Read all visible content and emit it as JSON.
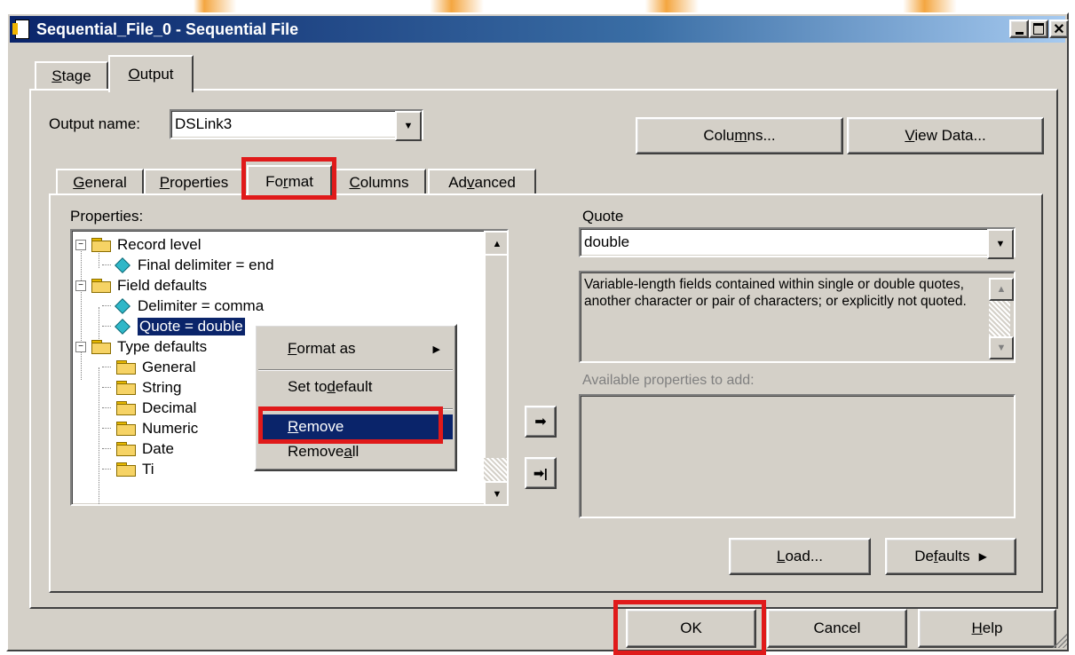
{
  "window": {
    "title": "Sequential_File_0 - Sequential File",
    "title_bar_color": "#0a246a",
    "face_color": "#d4d0c8"
  },
  "top_tabs": [
    {
      "label": "Stage",
      "accel": "S",
      "rest": "tage"
    },
    {
      "label": "Output",
      "accel": "O",
      "rest": "utput",
      "active": true
    }
  ],
  "output_name": {
    "label": "Output name:",
    "value": "DSLink3"
  },
  "top_buttons": {
    "columns": {
      "pre": "Colu",
      "accel": "m",
      "post": "ns..."
    },
    "view_data": {
      "pre": "",
      "accel": "V",
      "post": "iew Data..."
    }
  },
  "sub_tabs": [
    {
      "pre": "",
      "accel": "G",
      "post": "eneral"
    },
    {
      "pre": "",
      "accel": "P",
      "post": "roperties"
    },
    {
      "pre": "Fo",
      "accel": "r",
      "post": "mat",
      "active": true
    },
    {
      "pre": "",
      "accel": "C",
      "post": "olumns"
    },
    {
      "pre": "Ad",
      "accel": "v",
      "post": "anced"
    }
  ],
  "properties_label": "Properties:",
  "tree": [
    {
      "text": "Record level",
      "kind": "folder",
      "level": 0,
      "expander": "−"
    },
    {
      "text": "Final delimiter = end",
      "kind": "prop",
      "level": 1
    },
    {
      "text": "Field defaults",
      "kind": "folder",
      "level": 0,
      "expander": "−"
    },
    {
      "text": "Delimiter = comma",
      "kind": "prop",
      "level": 1
    },
    {
      "text": "Quote = double",
      "kind": "prop",
      "level": 1,
      "selected": true
    },
    {
      "text": "Type defaults",
      "kind": "folder",
      "level": 0,
      "expander": "−"
    },
    {
      "text": "General",
      "kind": "folder",
      "level": 1
    },
    {
      "text": "String",
      "kind": "folder",
      "level": 1
    },
    {
      "text": "Decimal",
      "kind": "folder",
      "level": 1
    },
    {
      "text": "Numeric",
      "kind": "folder",
      "level": 1
    },
    {
      "text": "Date",
      "kind": "folder",
      "level": 1
    },
    {
      "text": "Ti",
      "kind": "folder",
      "level": 1
    }
  ],
  "context_menu": [
    {
      "pre": "",
      "accel": "F",
      "post": "ormat as",
      "submenu": true
    },
    {
      "pre": "Set to ",
      "accel": "d",
      "post": "efault"
    },
    {
      "pre": "",
      "accel": "R",
      "post": "emove",
      "highlighted": true
    },
    {
      "pre": "Remove ",
      "accel": "a",
      "post": "ll"
    }
  ],
  "quote": {
    "label": "Quote",
    "value": "double",
    "description": "Variable-length fields contained within single or double quotes, another character or pair of characters; or explicitly not quoted."
  },
  "available_label": "Available properties to add:",
  "bottom_right_buttons": {
    "load": {
      "pre": "",
      "accel": "L",
      "post": "oad..."
    },
    "defaults": {
      "pre": "De",
      "accel": "f",
      "post": "aults"
    }
  },
  "dialog_buttons": {
    "ok": "OK",
    "cancel": "Cancel",
    "help": {
      "pre": "",
      "accel": "H",
      "post": "elp"
    }
  }
}
